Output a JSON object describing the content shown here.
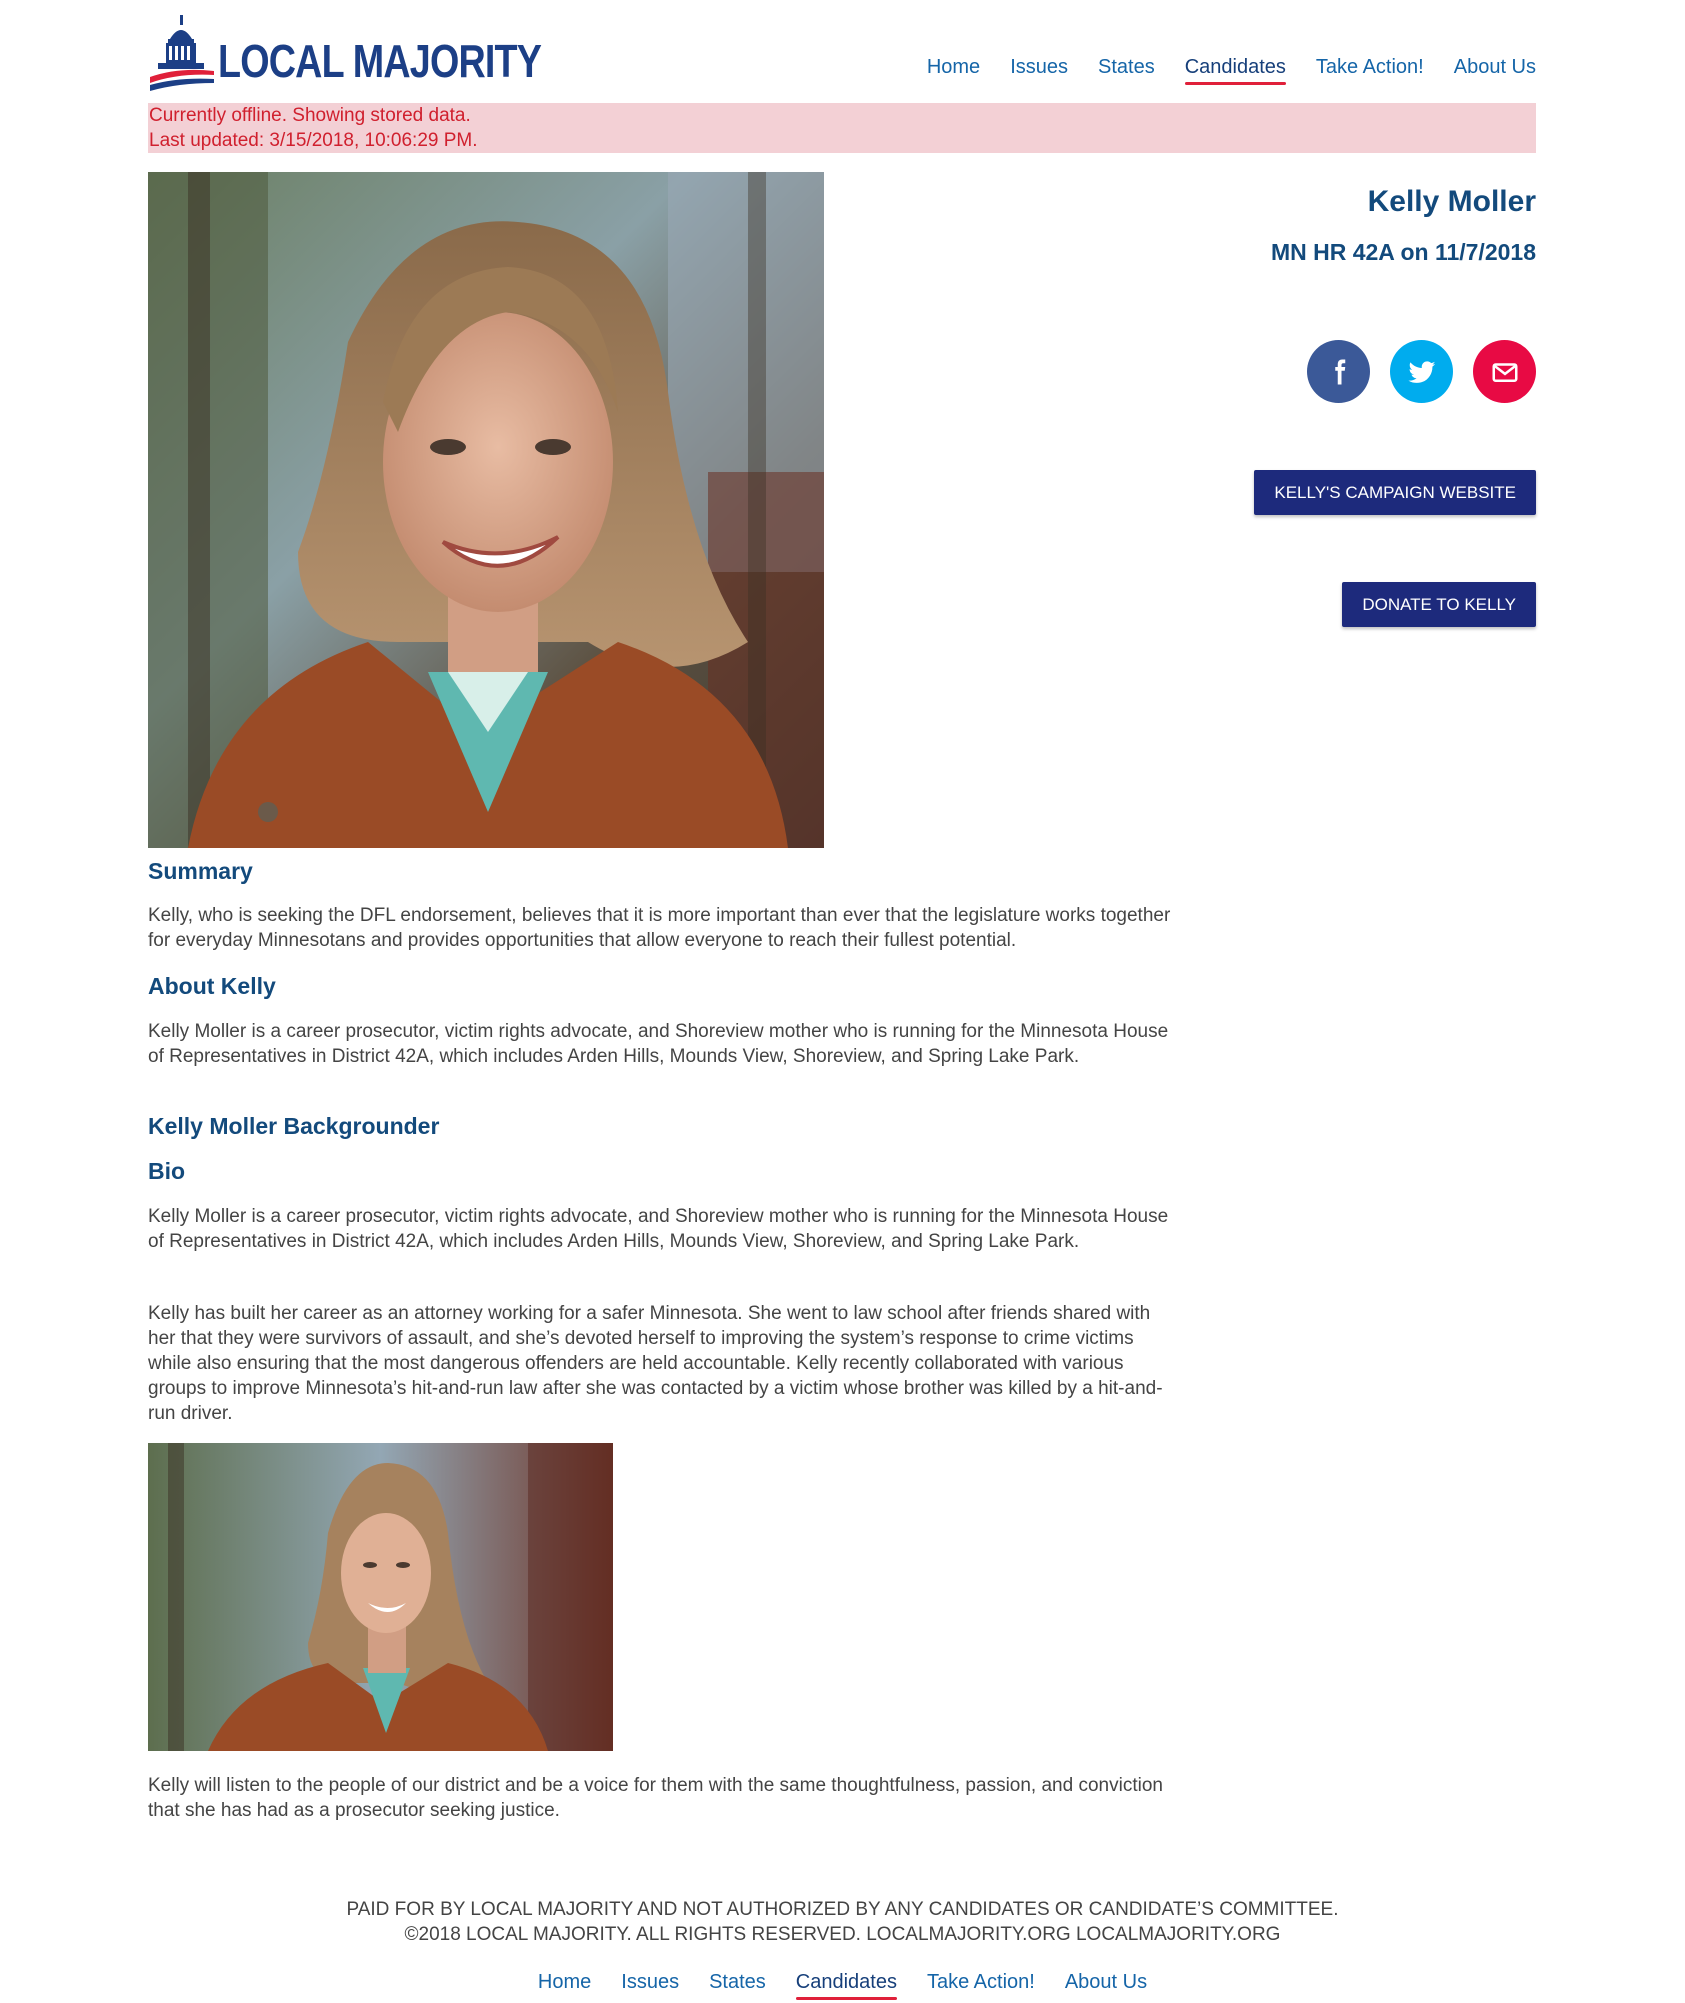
{
  "brand": {
    "logo_text": "LOCAL MAJORITY"
  },
  "nav": {
    "items": [
      {
        "label": "Home"
      },
      {
        "label": "Issues"
      },
      {
        "label": "States"
      },
      {
        "label": "Candidates",
        "active": true
      },
      {
        "label": "Take Action!"
      },
      {
        "label": "About Us"
      }
    ]
  },
  "offline": {
    "line1": "Currently offline. Showing stored data.",
    "line2": "Last updated: 3/15/2018, 10:06:29 PM."
  },
  "candidate": {
    "name": "Kelly Moller",
    "race": "MN HR 42A on 11/7/2018",
    "campaign_button": "KELLY'S CAMPAIGN WEBSITE",
    "donate_button": "DONATE TO KELLY"
  },
  "socials": [
    {
      "name": "facebook-icon",
      "color": "#3b5998"
    },
    {
      "name": "twitter-icon",
      "color": "#00acee"
    },
    {
      "name": "email-icon",
      "color": "#e80a44"
    }
  ],
  "sections": {
    "summary_title": "Summary",
    "summary_text": "Kelly, who is seeking the DFL endorsement, believes that it is more important than ever that the legislature works together for everyday Minnesotans and provides opportunities that allow everyone to reach their fullest potential.",
    "about_title": "About Kelly",
    "about_text": "Kelly Moller is a career prosecutor, victim rights advocate, and Shoreview mother who is running for the Minnesota House of Representatives in District 42A, which includes Arden Hills, Mounds View, Shoreview, and Spring Lake Park.",
    "backgrounder_title": "Kelly Moller Backgrounder",
    "bio_title": "Bio",
    "bio_p1": "Kelly Moller is a career prosecutor, victim rights advocate, and Shoreview mother who is running for the Minnesota House of Representatives in District 42A, which includes Arden Hills, Mounds View, Shoreview, and Spring Lake Park.",
    "bio_p2": "Kelly has built her career as an attorney working for a safer Minnesota. She went to law school after friends shared with her that they were survivors of assault, and she’s devoted herself to improving the system’s response to crime victims while also ensuring that the most dangerous offenders are held accountable. Kelly recently collaborated with various groups to improve Minnesota’s hit-and-run law after she was contacted by a victim whose brother was killed by a hit-and-run driver.",
    "bio_p3": "Kelly will listen to the people of our district and be a voice for them with the same thoughtfulness, passion, and conviction that she has had as a prosecutor seeking justice."
  },
  "footer": {
    "disclaimer": "PAID FOR BY LOCAL MAJORITY AND NOT AUTHORIZED BY ANY CANDIDATES OR CANDIDATE’S COMMITTEE.",
    "copyright": "©2018 LOCAL MAJORITY. ALL RIGHTS RESERVED. LOCALMAJORITY.ORG LOCALMAJORITY.ORG",
    "nav": [
      {
        "label": "Home"
      },
      {
        "label": "Issues"
      },
      {
        "label": "States"
      },
      {
        "label": "Candidates",
        "active": true
      },
      {
        "label": "Take Action!"
      },
      {
        "label": "About Us"
      }
    ]
  },
  "colors": {
    "brand_blue": "#1c3f86",
    "heading_blue": "#134a7c",
    "link_blue": "#1565a8",
    "accent_red": "#e0203a",
    "button_navy": "#1d2a7c",
    "offline_bg": "#f3d0d5"
  }
}
